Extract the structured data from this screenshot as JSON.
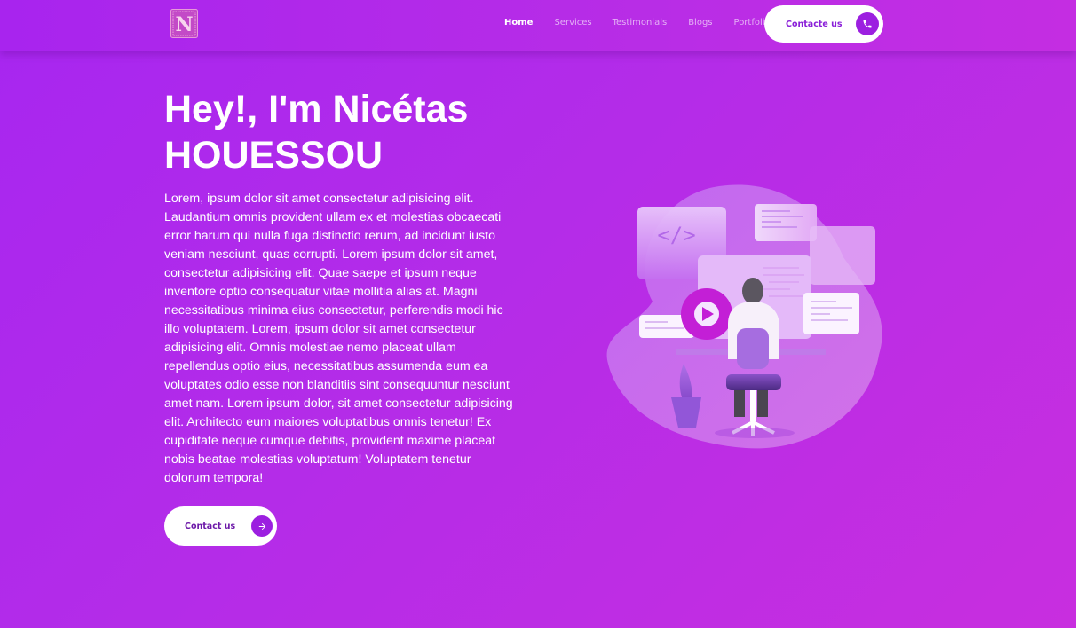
{
  "header": {
    "logo_icon": "n-monogram-logo",
    "logo_letter": "N",
    "nav": [
      {
        "label": "Home",
        "active": true
      },
      {
        "label": "Services",
        "active": false
      },
      {
        "label": "Testimonials",
        "active": false
      },
      {
        "label": "Blogs",
        "active": false
      },
      {
        "label": "Portfolio",
        "active": false
      }
    ],
    "cta_label": "Contacte us",
    "cta_icon": "phone-icon"
  },
  "hero": {
    "title": "Hey!, I'm Nicétas HOUESSOU",
    "paragraph": "Lorem, ipsum dolor sit amet consectetur adipisicing elit. Laudantium omnis provident ullam ex et molestias obcaecati error harum qui nulla fuga distinctio rerum, ad incidunt iusto veniam nesciunt, quas corrupti. Lorem ipsum dolor sit amet, consectetur adipisicing elit. Quae saepe et ipsum neque inventore optio consequatur vitae mollitia alias at. Magni necessitatibus minima eius consectetur, perferendis modi hic illo voluptatem. Lorem, ipsum dolor sit amet consectetur adipisicing elit. Omnis molestiae nemo placeat ullam repellendus optio eius, necessitatibus assumenda eum ea voluptates odio esse non blanditiis sint consequuntur nesciunt amet nam. Lorem ipsum dolor, sit amet consectetur adipisicing elit. Architecto eum maiores voluptatibus omnis tenetur! Ex cupiditate neque cumque debitis, provident maxime placeat nobis beatae molestias voluptatum! Voluptatem tenetur dolorum tempora!",
    "cta_label": "Contact us",
    "cta_icon": "arrow-right-icon",
    "illustration": "developer-at-desk-illustration",
    "code_glyph": "</>"
  },
  "colors": {
    "background_start": "#a726f0",
    "background_end": "#c82edf",
    "accent": "#9c1fe0",
    "button_bg": "#ffffff"
  }
}
